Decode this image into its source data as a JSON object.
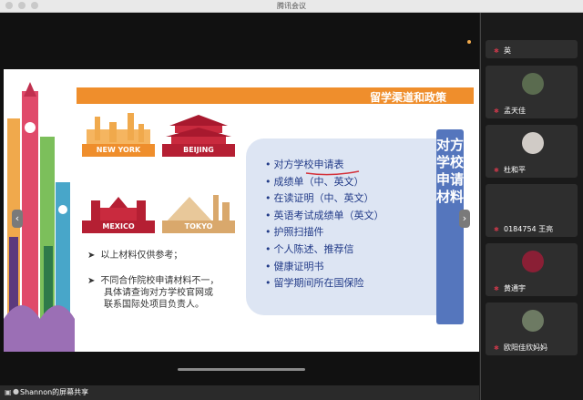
{
  "window": {
    "title": "腾讯会议"
  },
  "slide": {
    "banner": "留学渠道和政策",
    "cities": [
      "NEW YORK",
      "BEIJING",
      "MEXICO",
      "TOKYO"
    ],
    "list": [
      "对方学校申请表",
      "成绩单（中、英文）",
      "在读证明（中、英文）",
      "英语考试成绩单（英文）",
      "护照扫描件",
      "个人陈述、推荐信",
      "健康证明书",
      "留学期间所在国保险"
    ],
    "vertical_title": "对方学校申请材料",
    "notes": [
      "以上材料仅供参考；",
      "不同合作院校申请材料不一，",
      "具体请查询对方学校官网或",
      "联系国际处项目负责人。"
    ]
  },
  "share_status": {
    "text": "Shannon的屏幕共享"
  },
  "nav": {
    "prev": "‹",
    "next": "›"
  },
  "participants": [
    {
      "name": "英"
    },
    {
      "name": "孟天佳"
    },
    {
      "name": "杜和平"
    },
    {
      "name": "0184754 王亮"
    },
    {
      "name": "黄通宇"
    },
    {
      "name": "欧阳佳欣妈妈"
    }
  ],
  "colors": {
    "banner": "#ef8e2c",
    "list_text": "#223b88",
    "vertical_panel": "#5576bd",
    "panel_bg": "#dde5f3"
  }
}
